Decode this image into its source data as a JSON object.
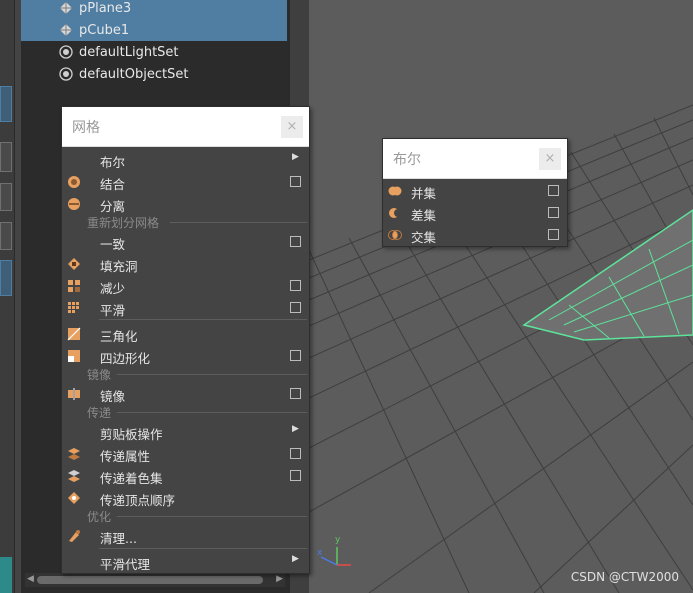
{
  "outliner": {
    "items": [
      {
        "label": "pPlane3",
        "selected": true,
        "icon": "mesh-transform-icon"
      },
      {
        "label": "pCube1",
        "selected": true,
        "icon": "mesh-transform-icon"
      },
      {
        "label": "defaultLightSet",
        "selected": false,
        "icon": "set-icon"
      },
      {
        "label": "defaultObjectSet",
        "selected": false,
        "icon": "set-icon"
      }
    ]
  },
  "mesh_menu": {
    "title": "网格",
    "close": "×",
    "items": {
      "boolean": "布尔",
      "combine": "结合",
      "separate": "分离",
      "conform": "一致",
      "fill_hole": "填充洞",
      "reduce": "减少",
      "smooth": "平滑",
      "triangulate": "三角化",
      "quadrangulate": "四边形化",
      "mirror": "镜像",
      "clipboard": "剪贴板操作",
      "transfer_attributes": "传递属性",
      "transfer_shading_sets": "传递着色集",
      "transfer_vertex_order": "传递顶点顺序",
      "cleanup": "清理...",
      "smooth_proxy": "平滑代理"
    },
    "sections": {
      "remesh": "重新划分网格",
      "mirror": "镜像",
      "transfer": "传递",
      "optimize": "优化"
    }
  },
  "boolean_menu": {
    "title": "布尔",
    "close": "×",
    "items": {
      "union": "并集",
      "difference": "差集",
      "intersection": "交集"
    }
  },
  "viewport": {
    "axis_y": "y",
    "axis_x": "x"
  },
  "watermark": "CSDN @CTW2000",
  "colors": {
    "selection": "#4f7ea2",
    "menu_bg": "#444444",
    "viewport_bg": "#5c5c5c",
    "plane_edge": "#5de39a",
    "icon_orange": "#e8a060"
  }
}
